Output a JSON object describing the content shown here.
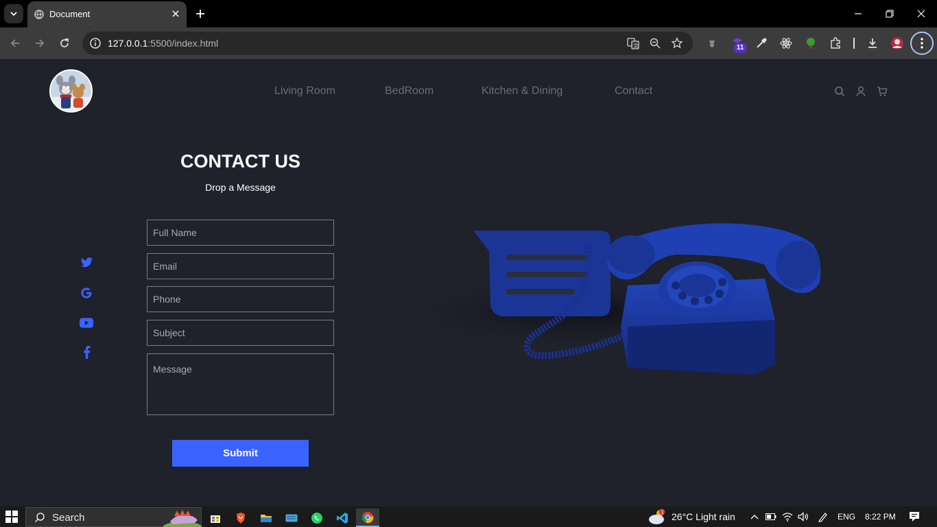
{
  "browser": {
    "tab_title": "Document",
    "url_host": "127.0.0.1",
    "url_rest": ":5500/index.html",
    "extension_badge": "11"
  },
  "site": {
    "nav": [
      "Living Room",
      "BedRoom",
      "Kitchen & Dining",
      "Contact"
    ],
    "header_icons": [
      "search-icon",
      "user-icon",
      "cart-icon"
    ],
    "social_icons": [
      "twitter-icon",
      "google-icon",
      "youtube-icon",
      "facebook-icon"
    ]
  },
  "contact": {
    "title": "CONTACT US",
    "subtitle": "Drop a Message",
    "placeholders": {
      "full_name": "Full Name",
      "email": "Email",
      "phone": "Phone",
      "subject": "Subject",
      "message": "Message"
    },
    "submit": "Submit"
  },
  "taskbar": {
    "search_label": "Search",
    "weather": "26°C  Light rain",
    "language": "ENG",
    "time": "8:22 PM"
  },
  "colors": {
    "page_bg": "#1f212b",
    "accent": "#3b63ff",
    "social": "#3b63ff",
    "phone": "#1c3aa8"
  }
}
